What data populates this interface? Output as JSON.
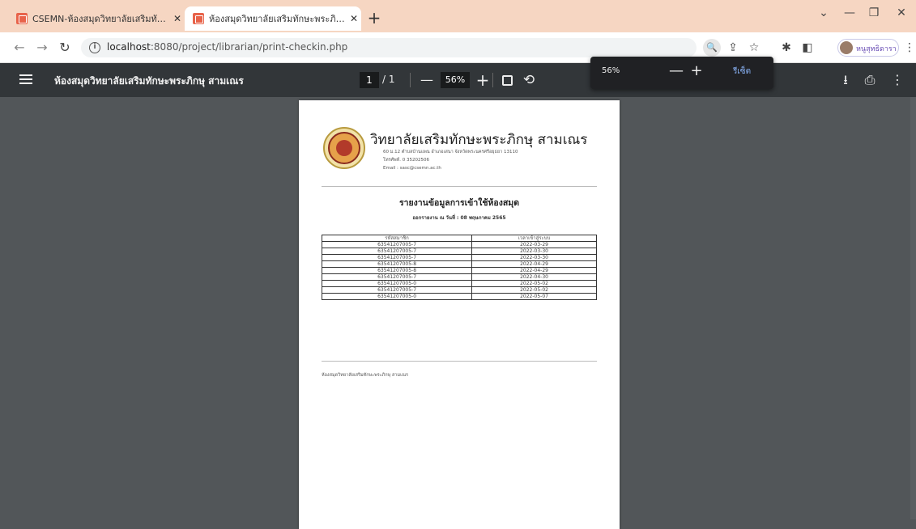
{
  "browser": {
    "tabs": [
      {
        "title": "CSEMN-ห้องสมุดวิทยาลัยเสริมทักษะ",
        "active": false
      },
      {
        "title": "ห้องสมุดวิทยาลัยเสริมทักษะพระภิกษุ สามเณร",
        "active": true
      }
    ],
    "url_prefix": "localhost",
    "url_rest": ":8080/project/librarian/print-checkin.php",
    "profile_name": "หนูสุทธิดารา"
  },
  "pdf_toolbar": {
    "title": "ห้องสมุดวิทยาลัยเสริมทักษะพระภิกษุ สามเณร",
    "page_current": "1",
    "page_total": "/ 1",
    "zoom": "56%"
  },
  "zoom_popup": {
    "value": "56%",
    "reset_label": "รีเซ็ต"
  },
  "document": {
    "school_name": "วิทยาลัยเสริมทักษะพระภิกษุ สามเณร",
    "address_line1": "60 ม.12 ตำบลบ้านแพน อำเภอเสนา จังหวัดพระนครศรีอยุธยา 13110",
    "address_line2": "โทรศัพท์. 0 35202506",
    "address_line3": "Email : sasc@csemn.ac.th",
    "report_title": "รายงานข้อมูลการเข้าใช้ห้องสมุด",
    "report_subtitle": "ออกรายงาน ณ วันที่ : 08 พฤษภาคม 2565",
    "table": {
      "headers": [
        "รหัสสมาชิก",
        "เวลาเข้าสู่ระบบ"
      ],
      "rows": [
        [
          "63541207005-7",
          "2022-03-29"
        ],
        [
          "63541207005-7",
          "2022-03-30"
        ],
        [
          "63541207005-7",
          "2022-03-30"
        ],
        [
          "63541207005-8",
          "2022-04-29"
        ],
        [
          "63541207005-8",
          "2022-04-29"
        ],
        [
          "63541207005-7",
          "2022-04-30"
        ],
        [
          "63541207005-0",
          "2022-05-02"
        ],
        [
          "63541207005-7",
          "2022-05-02"
        ],
        [
          "63541207005-0",
          "2022-05-07"
        ]
      ]
    },
    "footer": "ห้องสมุดวิทยาลัยเสริมทักษะพระภิกษุ สามเณร"
  }
}
